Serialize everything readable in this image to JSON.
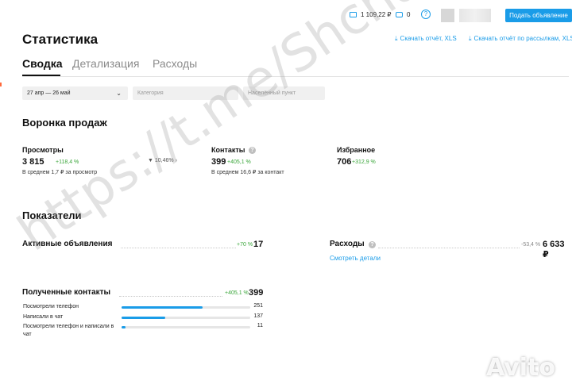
{
  "topbar": {
    "balance": "1 109,22 ₽",
    "bonus": "0",
    "help_icon": "?",
    "post_ad_label": "Подать объявление"
  },
  "header": {
    "title": "Статистика",
    "download_report": "Скачать отчёт, XLS",
    "download_mailing_report": "Скачать отчёт по рассылкам, XLS"
  },
  "tabs": [
    "Сводка",
    "Детализация",
    "Расходы"
  ],
  "filters": {
    "period": "27 апр — 26 май",
    "category_placeholder": "Категория",
    "city_placeholder": "Населённый пункт"
  },
  "funnel": {
    "title": "Воронка продаж",
    "conversion": "10,46%",
    "views": {
      "label": "Просмотры",
      "value": "3 815",
      "change": "+118,4 %",
      "sub": "В среднем 1,7 ₽ за просмотр"
    },
    "contacts": {
      "label": "Контакты",
      "value": "399",
      "change": "+405,1 %",
      "sub": "В среднем 16,6 ₽ за контакт"
    },
    "favorites": {
      "label": "Избранное",
      "value": "706",
      "change": "+312,9 %"
    }
  },
  "indicators": {
    "title": "Показатели",
    "active_ads": {
      "label": "Активные объявления",
      "change": "+70 %",
      "value": "17"
    },
    "expenses": {
      "label": "Расходы",
      "change": "-53,4 %",
      "value": "6 633 ₽",
      "details_link": "Смотреть детали"
    },
    "received_contacts": {
      "label": "Полученные контакты",
      "change": "+405,1 %",
      "value": "399",
      "rows": [
        {
          "label": "Посмотрели телефон",
          "value": "251",
          "fraction": 0.63
        },
        {
          "label": "Написали в чат",
          "value": "137",
          "fraction": 0.34
        },
        {
          "label": "Посмотрели телефон и написали в чат",
          "value": "11",
          "fraction": 0.03
        }
      ]
    }
  },
  "watermark": "https://t.me/Shchapova_",
  "logo": "Avito",
  "colors": {
    "accent": "#1a9ce8",
    "positive": "#3aa63a"
  }
}
